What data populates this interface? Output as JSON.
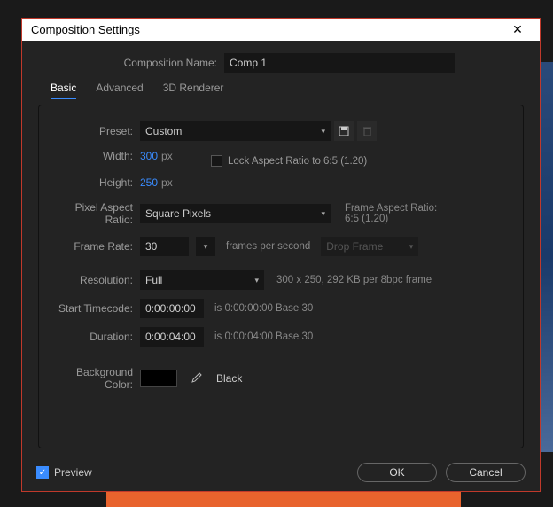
{
  "dialog_title": "Composition Settings",
  "name_label": "Composition Name:",
  "comp_name": "Comp 1",
  "tabs": {
    "basic": "Basic",
    "advanced": "Advanced",
    "renderer": "3D Renderer"
  },
  "preset_label": "Preset:",
  "preset_value": "Custom",
  "width_label": "Width:",
  "width_value": "300",
  "height_label": "Height:",
  "height_value": "250",
  "px_suffix": "px",
  "lock_ar_label": "Lock Aspect Ratio to 6:5 (1.20)",
  "par_label": "Pixel Aspect Ratio:",
  "par_value": "Square Pixels",
  "far_label": "Frame Aspect Ratio:",
  "far_value": "6:5 (1.20)",
  "fps_label": "Frame Rate:",
  "fps_value": "30",
  "fps_text": "frames per second",
  "dropframe": "Drop Frame",
  "res_label": "Resolution:",
  "res_value": "Full",
  "res_info": "300 x 250, 292 KB per 8bpc frame",
  "start_tc_label": "Start Timecode:",
  "start_tc_value": "0:00:00:00",
  "start_tc_info": "is 0:00:00:00  Base 30",
  "dur_label": "Duration:",
  "dur_value": "0:00:04:00",
  "dur_info": "is 0:00:04:00  Base 30",
  "bg_label": "Background Color:",
  "bg_color_name": "Black",
  "preview_label": "Preview",
  "ok": "OK",
  "cancel": "Cancel"
}
